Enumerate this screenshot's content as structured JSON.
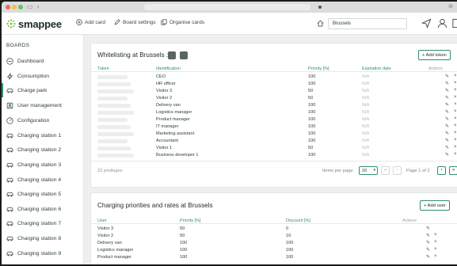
{
  "app": {
    "logo_text": "smappee",
    "accent": "#2f8f6e"
  },
  "toolbar": {
    "add_card": "Add card",
    "board_settings": "Board settings",
    "organise_cards": "Organise cards",
    "search_value": "Brussels"
  },
  "sidebar": {
    "heading": "BOARDS",
    "items": [
      {
        "label": "Dashboard",
        "icon": "minus-circle-icon"
      },
      {
        "label": "Consumption",
        "icon": "bolt-icon"
      },
      {
        "label": "Charge park",
        "icon": "car-icon",
        "active": true
      },
      {
        "label": "User management",
        "icon": "user-badge-icon"
      },
      {
        "label": "Configuration",
        "icon": "gauge-icon"
      },
      {
        "label": "Charging station 1",
        "icon": "car-icon"
      },
      {
        "label": "Charging station 2",
        "icon": "car-icon"
      },
      {
        "label": "Charging station 3",
        "icon": "car-icon"
      },
      {
        "label": "Charging station 4",
        "icon": "car-icon"
      },
      {
        "label": "Charging station 5",
        "icon": "car-icon"
      },
      {
        "label": "Charging station 6",
        "icon": "car-icon"
      },
      {
        "label": "Charging station 7",
        "icon": "car-icon"
      },
      {
        "label": "Charging station 8",
        "icon": "car-icon"
      },
      {
        "label": "Charging station 9",
        "icon": "car-icon"
      }
    ]
  },
  "whitelist": {
    "title": "Whitelisting at Brussels :",
    "add_label": "+ Add token",
    "columns": [
      "Token",
      "Identification",
      "Priority [%]",
      "Expiration date",
      "Actions"
    ],
    "rows": [
      {
        "id": "CEO",
        "priority": "100",
        "exp": "N/A"
      },
      {
        "id": "HR officer",
        "priority": "100",
        "exp": "N/A"
      },
      {
        "id": "Visitor 3",
        "priority": "50",
        "exp": "N/A"
      },
      {
        "id": "Visitor 2",
        "priority": "50",
        "exp": "N/A"
      },
      {
        "id": "Delivery van",
        "priority": "100",
        "exp": "N/A"
      },
      {
        "id": "Logistics manager",
        "priority": "100",
        "exp": "N/A"
      },
      {
        "id": "Product manager",
        "priority": "100",
        "exp": "N/A"
      },
      {
        "id": "IT manager",
        "priority": "100",
        "exp": "N/A"
      },
      {
        "id": "Marketing assistant",
        "priority": "100",
        "exp": "N/A"
      },
      {
        "id": "Accountant",
        "priority": "100",
        "exp": "N/A"
      },
      {
        "id": "Visitor 1",
        "priority": "50",
        "exp": "N/A"
      },
      {
        "id": "Business developer 1",
        "priority": "100",
        "exp": "N/A"
      }
    ],
    "count_label": "22 privileges",
    "items_per_page_label": "Items per page",
    "items_per_page_value": "20",
    "page_label": "Page 1 of 2"
  },
  "rates": {
    "title": "Charging priorities and rates at Brussels",
    "add_label": "+ Add user",
    "columns": [
      "User",
      "Priority [%]",
      "Discount [%]",
      "Actions"
    ],
    "rows": [
      {
        "user": "Visitor 3",
        "priority": "50",
        "discount": "0"
      },
      {
        "user": "Visitor 2",
        "priority": "50",
        "discount": "10"
      },
      {
        "user": "Delivery van",
        "priority": "100",
        "discount": "100"
      },
      {
        "user": "Logistics manager",
        "priority": "100",
        "discount": "100"
      },
      {
        "user": "Product manager",
        "priority": "100",
        "discount": "100"
      }
    ]
  }
}
